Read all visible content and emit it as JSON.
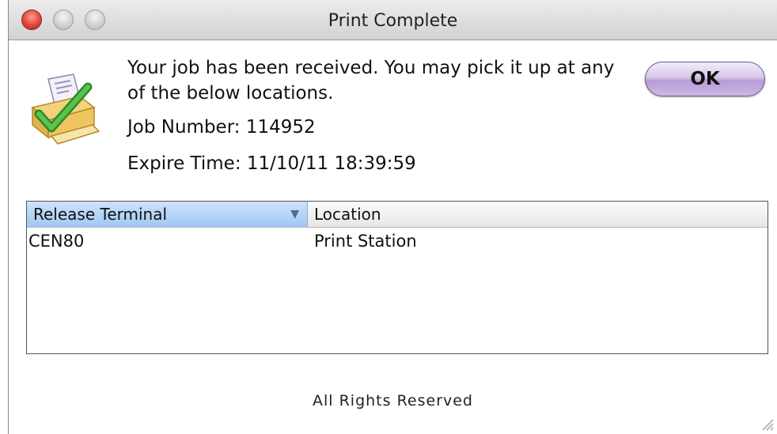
{
  "window": {
    "title": "Print Complete"
  },
  "dialog": {
    "message": "Your job has been received. You may pick it up at any of the below locations.",
    "job_number": "Job Number: 114952",
    "expire_time": "Expire Time: 11/10/11 18:39:59",
    "ok_label": "OK",
    "icon": "printer-checkmark-icon"
  },
  "table": {
    "columns": [
      "Release Terminal",
      "Location"
    ],
    "sorted_column": "Release Terminal",
    "rows": [
      [
        "CEN80",
        "Print Station"
      ]
    ]
  },
  "footer": {
    "text": "All Rights Reserved"
  },
  "colors": {
    "close_button": "#e0453a",
    "ok_button": "#c7b0e0",
    "selected_header": "#a9cdf3"
  }
}
